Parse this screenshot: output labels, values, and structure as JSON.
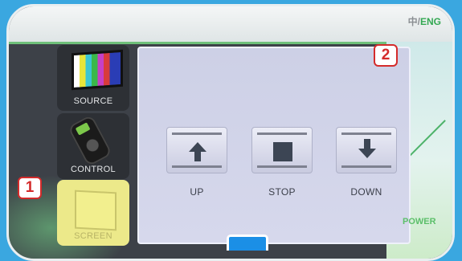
{
  "header": {
    "lang_zh": "中/",
    "lang_en": "ENG"
  },
  "sidebar": {
    "items": [
      {
        "label": "SOURCE",
        "icon": "tv-color-bars-icon"
      },
      {
        "label": "CONTROL",
        "icon": "remote-control-icon"
      },
      {
        "label": "SCREEN",
        "icon": "projection-screen-icon",
        "selected": true
      }
    ]
  },
  "panel": {
    "controls": [
      {
        "label": "UP",
        "icon": "arrow-up-icon"
      },
      {
        "label": "STOP",
        "icon": "stop-icon"
      },
      {
        "label": "DOWN",
        "icon": "arrow-down-icon"
      }
    ]
  },
  "footer": {
    "power_label": "POWER"
  },
  "annotations": {
    "badge_1": "1",
    "badge_2": "2"
  },
  "colors": {
    "accent_green": "#34a853",
    "badge_red": "#d42b2b",
    "selected_yellow": "#ece98a",
    "background_blue": "#3aa7e0"
  }
}
